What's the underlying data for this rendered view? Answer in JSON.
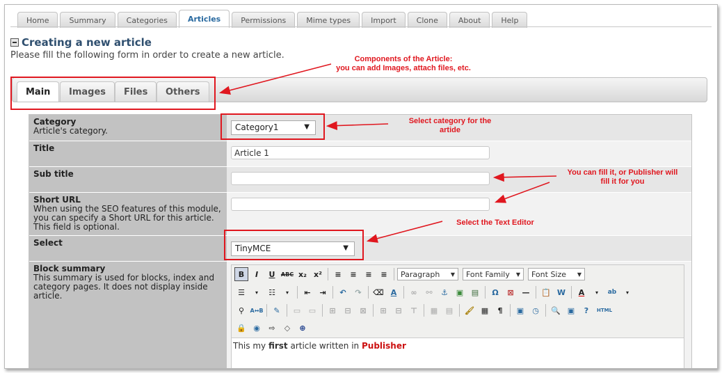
{
  "top_nav": {
    "tabs": [
      "Home",
      "Summary",
      "Categories",
      "Articles",
      "Permissions",
      "Mime types",
      "Import",
      "Clone",
      "About",
      "Help"
    ],
    "active": "Articles"
  },
  "page": {
    "title": "Creating a new article",
    "subtitle": "Please fill the following form in order to create a new article."
  },
  "inner_tabs": {
    "tabs": [
      "Main",
      "Images",
      "Files",
      "Others"
    ],
    "active": "Main"
  },
  "form": {
    "category": {
      "label": "Category",
      "desc": "Article's category.",
      "value": "Category1"
    },
    "title": {
      "label": "Title",
      "value": "Article 1"
    },
    "subtitle": {
      "label": "Sub title",
      "value": ""
    },
    "short_url": {
      "label": "Short URL",
      "desc": "When using the SEO features of this module, you can specify a Short URL for this article. This field is optional.",
      "value": ""
    },
    "select": {
      "label": "Select",
      "value": "TinyMCE"
    },
    "block_summary": {
      "label": "Block summary",
      "desc": "This summary is used for blocks, index and category pages. It does not display inside article."
    }
  },
  "editor": {
    "paragraph": "Paragraph",
    "font_family": "Font Family",
    "font_size": "Font Size",
    "content": {
      "pre": "This my ",
      "bold": "first",
      "mid": " article written in ",
      "colored": "Publisher"
    }
  },
  "annotations": {
    "components_line1": "Components of the Article:",
    "components_line2": "you can add Images, attach files, etc.",
    "category_line1": "Select category for the",
    "category_line2": "artide",
    "fill_line1": "You can fill it, or Publisher will",
    "fill_line2": "fill it for you",
    "editor": "Select the Text Editor"
  },
  "colors": {
    "annotation": "#e0171f",
    "heading": "#2f4f6f",
    "link": "#2a6aa0"
  }
}
